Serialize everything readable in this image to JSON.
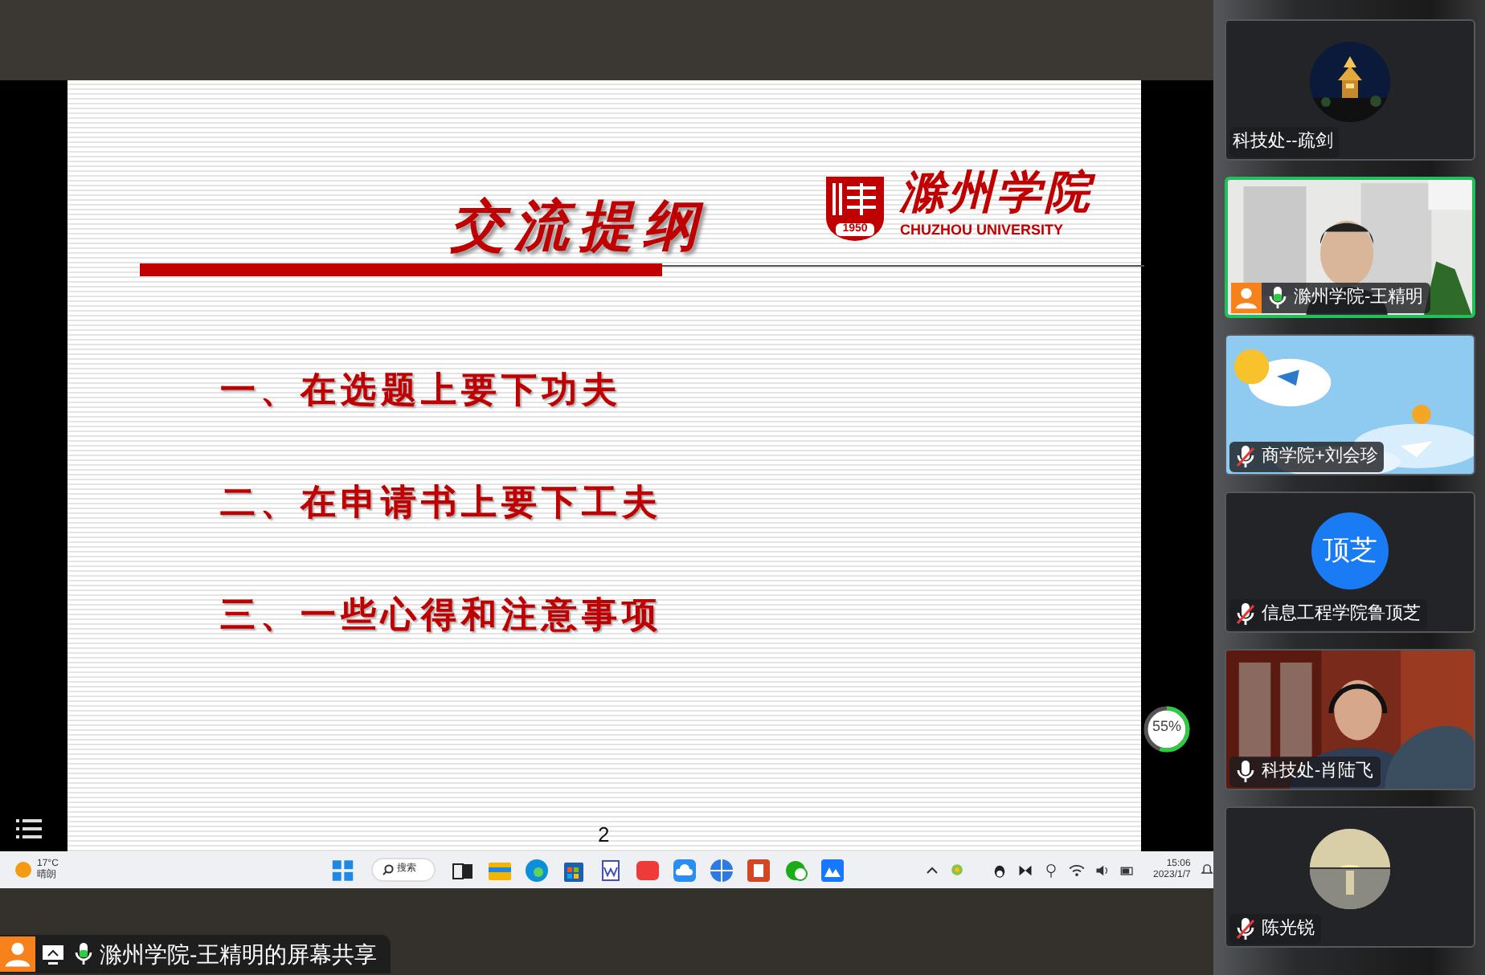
{
  "slide": {
    "title": "交流提纲",
    "logo": {
      "name": "滁州学院",
      "english": "CHUZHOU UNIVERSITY",
      "year": "1950"
    },
    "items": [
      "一、在选题上要下功夫",
      "二、在申请书上要下工夫",
      "三、一些心得和注意事项"
    ],
    "page_number": "2"
  },
  "speed_meter": {
    "reading": "55%",
    "level": 0.55
  },
  "taskbar": {
    "weather": {
      "temperature": "17°C",
      "condition": "晴朗"
    },
    "search": {
      "placeholder": "搜索"
    },
    "clock": {
      "time": "15:06",
      "date": "2023/1/7"
    }
  },
  "share_label": {
    "text": "滁州学院-王精明的屏幕共享",
    "host": true,
    "mic": {
      "kind": "active"
    }
  },
  "participants": [
    {
      "name": "科技处--疏剑",
      "kind": "photo_avatar",
      "host": false,
      "speaking": false
    },
    {
      "name": "滁州学院-王精明",
      "kind": "video",
      "mic": {
        "kind": "active"
      },
      "host": true,
      "speaking": true
    },
    {
      "name": "商学院+刘会珍",
      "kind": "video",
      "mic": {
        "kind": "muted"
      },
      "host": false,
      "speaking": false
    },
    {
      "name": "信息工程学院鲁顶芝",
      "kind": "initials",
      "initials": "顶芝",
      "mic": {
        "kind": "muted"
      },
      "host": false,
      "speaking": false
    },
    {
      "name": "科技处-肖陆飞",
      "kind": "video",
      "mic": {
        "kind": "on"
      },
      "host": false,
      "speaking": false
    },
    {
      "name": "陈光锐",
      "kind": "photo_avatar",
      "mic": {
        "kind": "muted"
      },
      "host": false,
      "speaking": false
    }
  ]
}
